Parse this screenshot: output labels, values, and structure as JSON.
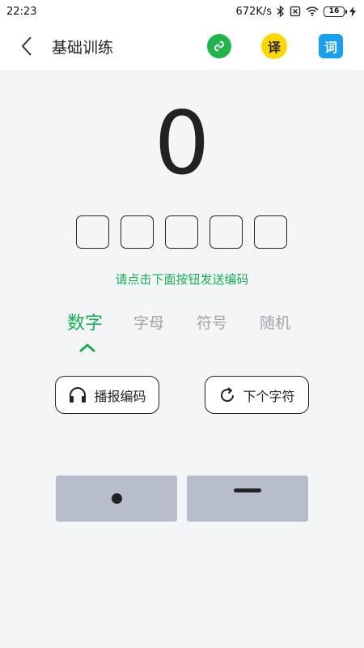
{
  "status_bar": {
    "time": "22:23",
    "net_speed": "672K/s",
    "battery": "16"
  },
  "app_bar": {
    "title": "基础训练",
    "translate_label": "译",
    "word_label": "词"
  },
  "main": {
    "current_char": "0",
    "code_slots": [
      "",
      "",
      "",
      "",
      ""
    ],
    "hint": "请点击下面按钮发送编码",
    "tabs": [
      {
        "label": "数字",
        "active": true
      },
      {
        "label": "字母",
        "active": false
      },
      {
        "label": "符号",
        "active": false
      },
      {
        "label": "随机",
        "active": false
      }
    ],
    "play_label": "播报编码",
    "next_label": "下个字符"
  },
  "keys": {
    "dot": "dot-key",
    "dash": "dash-key"
  },
  "colors": {
    "accent": "#17b056",
    "key_bg": "#b7bdca",
    "page_bg": "#f4f5f7",
    "link_green": "#1fb54b",
    "translate_yellow": "#ffd700",
    "word_blue": "#17a0f0"
  }
}
